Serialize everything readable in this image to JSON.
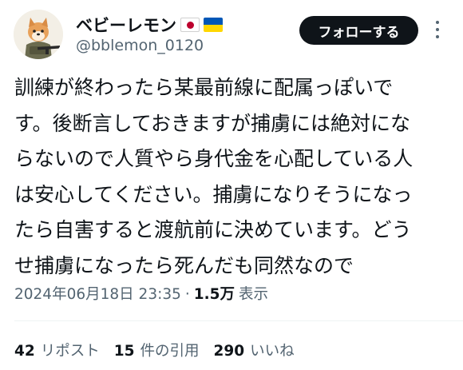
{
  "author": {
    "display_name": "ベビーレモン",
    "flags": [
      "japan-flag",
      "ukraine-flag"
    ],
    "handle": "@bblemon_0120",
    "avatar_icon": "soldier-dog-avatar"
  },
  "follow_label": "フォローする",
  "tweet": {
    "lines": [
      "訓練が終わったら某最前線に配属っぽいで",
      "す。後断言しておきますが捕虜には絶対にな",
      "らないので人質やら身代金を心配している人",
      "は安心してください。捕虜になりそうになっ",
      "たら自害すると渡航前に決めています。どう",
      "せ捕虜になったら死んだも同然なので"
    ]
  },
  "meta": {
    "timestamp": "2024年06月18日 23:35",
    "separator": "·",
    "views_count": "1.5万",
    "views_label": "表示"
  },
  "stats": {
    "reposts_count": "42",
    "reposts_label": "リポスト",
    "quotes_count": "15",
    "quotes_label": "件の引用",
    "likes_count": "290",
    "likes_label": "いいね"
  },
  "colors": {
    "text": "#0f1419",
    "secondary": "#536471",
    "button_bg": "#0f1419",
    "divider": "#eff3f4"
  }
}
